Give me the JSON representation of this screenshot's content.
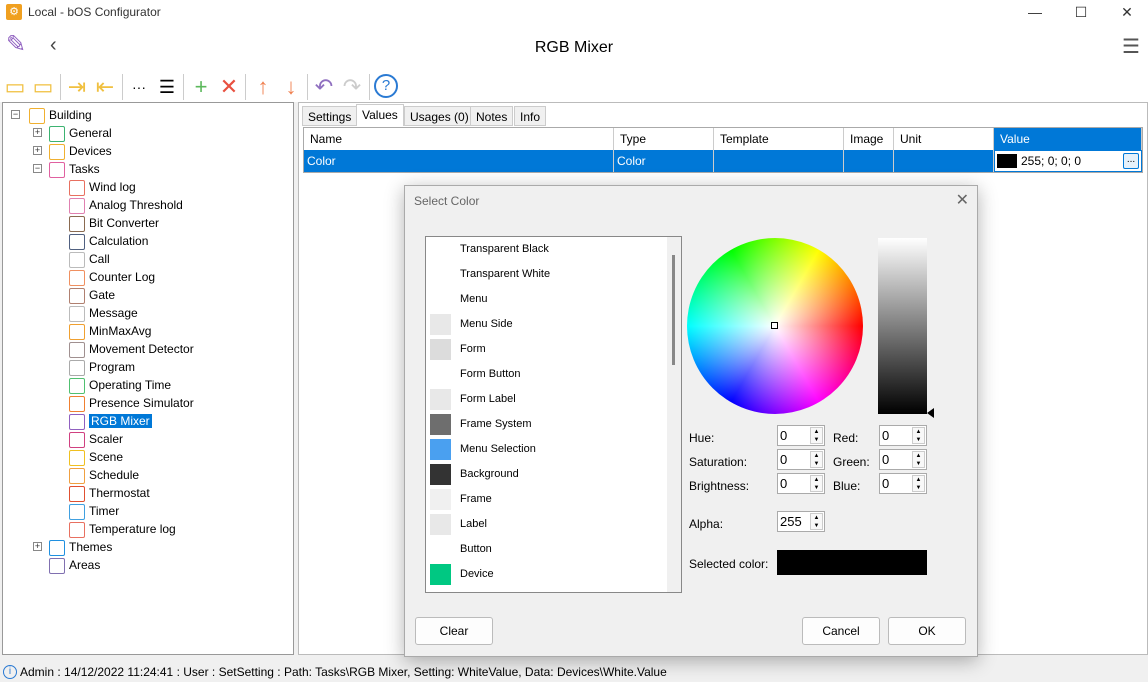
{
  "window": {
    "title": "Local - bOS Configurator"
  },
  "header": {
    "title": "RGB Mixer"
  },
  "tree": {
    "root": "Building",
    "items": [
      {
        "label": "General",
        "color": "#3cb371",
        "level": 1,
        "expander": "+"
      },
      {
        "label": "Devices",
        "color": "#f0b030",
        "level": 1,
        "expander": "+"
      },
      {
        "label": "Tasks",
        "color": "#e060a0",
        "level": 1,
        "expander": "-"
      },
      {
        "label": "Wind log",
        "color": "#e87060",
        "level": 2
      },
      {
        "label": "Analog Threshold",
        "color": "#e080b0",
        "level": 2
      },
      {
        "label": "Bit Converter",
        "color": "#8a6a50",
        "level": 2
      },
      {
        "label": "Calculation",
        "color": "#506080",
        "level": 2
      },
      {
        "label": "Call",
        "color": "#bbbbbb",
        "level": 2
      },
      {
        "label": "Counter Log",
        "color": "#f09060",
        "level": 2
      },
      {
        "label": "Gate",
        "color": "#b08070",
        "level": 2
      },
      {
        "label": "Message",
        "color": "#bbbbbb",
        "level": 2
      },
      {
        "label": "MinMaxAvg",
        "color": "#f0a030",
        "level": 2
      },
      {
        "label": "Movement Detector",
        "color": "#a09090",
        "level": 2
      },
      {
        "label": "Program",
        "color": "#aaaaaa",
        "level": 2
      },
      {
        "label": "Operating Time",
        "color": "#50c070",
        "level": 2
      },
      {
        "label": "Presence Simulator",
        "color": "#f08030",
        "level": 2
      },
      {
        "label": "RGB Mixer",
        "color": "#9060c0",
        "level": 2,
        "selected": true
      },
      {
        "label": "Scaler",
        "color": "#d04080",
        "level": 2
      },
      {
        "label": "Scene",
        "color": "#f0c020",
        "level": 2
      },
      {
        "label": "Schedule",
        "color": "#f0a040",
        "level": 2
      },
      {
        "label": "Thermostat",
        "color": "#e05030",
        "level": 2
      },
      {
        "label": "Timer",
        "color": "#40a0e0",
        "level": 2
      },
      {
        "label": "Temperature log",
        "color": "#e87060",
        "level": 2
      },
      {
        "label": "Themes",
        "color": "#2090e0",
        "level": 1,
        "expander": "+"
      },
      {
        "label": "Areas",
        "color": "#8070b0",
        "level": 1
      }
    ]
  },
  "tabs": [
    {
      "label": "Settings"
    },
    {
      "label": "Values",
      "active": true
    },
    {
      "label": "Usages (0)"
    },
    {
      "label": "Notes"
    },
    {
      "label": "Info"
    }
  ],
  "grid": {
    "columns": [
      "Name",
      "Type",
      "Template",
      "Image",
      "Unit",
      "Value"
    ],
    "row": {
      "name": "Color",
      "type": "Color",
      "template": "",
      "image": "",
      "unit": "",
      "value": "255; 0; 0; 0",
      "ellipsis": "..."
    }
  },
  "dialog": {
    "title": "Select Color",
    "colors": [
      {
        "name": "Transparent Black",
        "swatch": ""
      },
      {
        "name": "Transparent White",
        "swatch": ""
      },
      {
        "name": "Menu",
        "swatch": ""
      },
      {
        "name": "Menu Side",
        "swatch": "#e8e8e8"
      },
      {
        "name": "Form",
        "swatch": "#dcdcdc"
      },
      {
        "name": "Form Button",
        "swatch": ""
      },
      {
        "name": "Form Label",
        "swatch": "#e8e8e8"
      },
      {
        "name": "Frame System",
        "swatch": "#6e6e6e"
      },
      {
        "name": "Menu Selection",
        "swatch": "#4aa0f0"
      },
      {
        "name": "Background",
        "swatch": "#333333"
      },
      {
        "name": "Frame",
        "swatch": "#f0f0f0"
      },
      {
        "name": "Label",
        "swatch": "#e8e8e8"
      },
      {
        "name": "Button",
        "swatch": ""
      },
      {
        "name": "Device",
        "swatch": "#00c882"
      }
    ],
    "fields": {
      "hue_label": "Hue:",
      "hue": "0",
      "saturation_label": "Saturation:",
      "saturation": "0",
      "brightness_label": "Brightness:",
      "brightness": "0",
      "red_label": "Red:",
      "red": "0",
      "green_label": "Green:",
      "green": "0",
      "blue_label": "Blue:",
      "blue": "0",
      "alpha_label": "Alpha:",
      "alpha": "255",
      "selected_label": "Selected color:",
      "selected_color": "#000000"
    },
    "buttons": {
      "clear": "Clear",
      "cancel": "Cancel",
      "ok": "OK"
    }
  },
  "status": {
    "text": "Admin : 14/12/2022 11:24:41 : User : SetSetting : Path: Tasks\\RGB Mixer, Setting: WhiteValue, Data: Devices\\White.Value"
  }
}
